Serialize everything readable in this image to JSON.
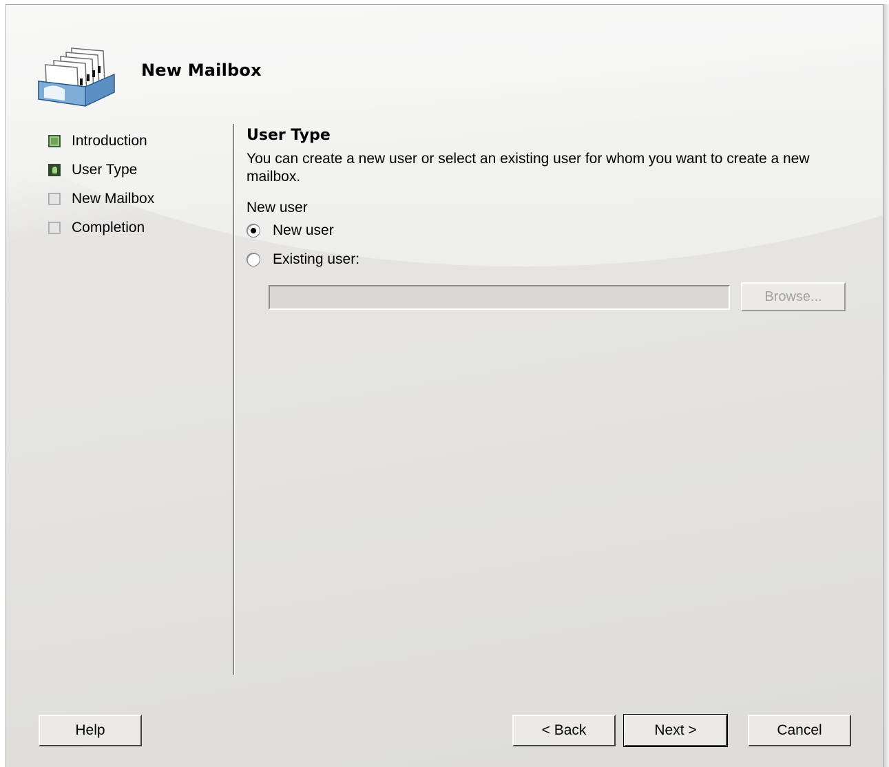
{
  "dialog": {
    "title": "New Mailbox"
  },
  "steps": [
    {
      "label": "Introduction",
      "state": "completed"
    },
    {
      "label": "User Type",
      "state": "current"
    },
    {
      "label": "New Mailbox",
      "state": "pending"
    },
    {
      "label": "Completion",
      "state": "pending"
    }
  ],
  "content": {
    "section_title": "User Type",
    "description": "You can create a new user or select an existing user for whom you want to create a new mailbox.",
    "group_label": "New user",
    "options": [
      {
        "label": "New user",
        "selected": true
      },
      {
        "label": "Existing user:",
        "selected": false
      }
    ],
    "existing_user_value": "",
    "browse_label": "Browse..."
  },
  "buttons": {
    "help": "Help",
    "back": "< Back",
    "next": "Next >",
    "cancel": "Cancel"
  },
  "icons": {
    "header": "mailbox-tray-icon",
    "step_completed": "step-completed-icon",
    "step_current": "step-current-icon",
    "step_pending": "step-pending-icon"
  },
  "colors": {
    "step_completed": "#6ea55a",
    "step_current": "#2f4a2a",
    "step_pending": "#e5e5e5",
    "tray_blue": "#5b8fc4"
  }
}
